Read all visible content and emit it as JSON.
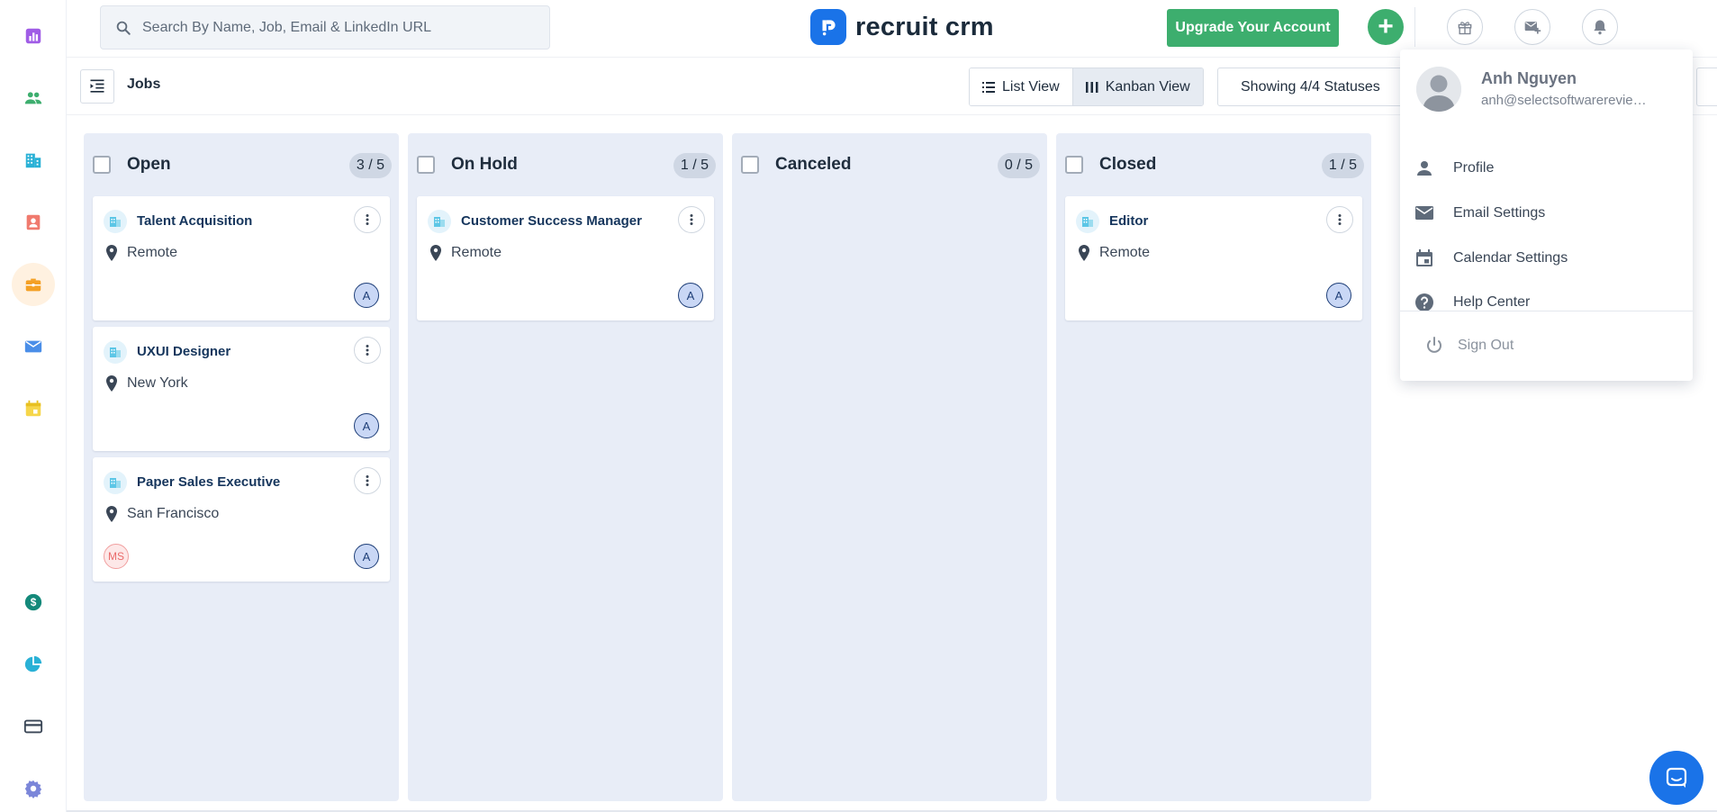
{
  "search": {
    "placeholder": "Search By Name, Job, Email & LinkedIn URL"
  },
  "brand": {
    "name": "recruit crm",
    "accent": "#1a73e8",
    "green": "#3dae6e"
  },
  "header": {
    "upgrade_label": "Upgrade Your Account",
    "add_label": "+"
  },
  "subheader": {
    "title": "Jobs",
    "list_view_label": "List View",
    "kanban_view_label": "Kanban View",
    "status_filter": "Showing 4/4 Statuses"
  },
  "sidebar": {
    "items": [
      {
        "icon": "reports-icon"
      },
      {
        "icon": "candidates-icon"
      },
      {
        "icon": "companies-icon"
      },
      {
        "icon": "contacts-icon"
      },
      {
        "icon": "jobs-icon",
        "active": true
      },
      {
        "icon": "email-icon"
      },
      {
        "icon": "calendar-icon"
      },
      {
        "icon": "billing-icon"
      },
      {
        "icon": "analytics-icon"
      },
      {
        "icon": "card-icon"
      },
      {
        "icon": "settings-icon"
      }
    ]
  },
  "columns": [
    {
      "title": "Open",
      "count": "3 / 5",
      "cards": [
        {
          "title": "Talent Acquisition",
          "location": "Remote",
          "assignee": "A"
        },
        {
          "title": "UXUI Designer",
          "location": "New York",
          "assignee": "A"
        },
        {
          "title": "Paper Sales Executive",
          "location": "San Francisco",
          "assignee": "A",
          "owner": "MS"
        }
      ]
    },
    {
      "title": "On Hold",
      "count": "1 / 5",
      "cards": [
        {
          "title": "Customer Success Manager",
          "location": "Remote",
          "assignee": "A"
        }
      ]
    },
    {
      "title": "Canceled",
      "count": "0 / 5",
      "cards": []
    },
    {
      "title": "Closed",
      "count": "1 / 5",
      "cards": [
        {
          "title": "Editor",
          "location": "Remote",
          "assignee": "A"
        }
      ]
    }
  ],
  "user_menu": {
    "name": "Anh Nguyen",
    "email": "anh@selectsoftwarereviews.com",
    "items": [
      {
        "label": "Profile",
        "icon": "person-icon"
      },
      {
        "label": "Email Settings",
        "icon": "mail-icon"
      },
      {
        "label": "Calendar Settings",
        "icon": "calendar-icon"
      },
      {
        "label": "Help Center",
        "icon": "help-icon"
      }
    ],
    "sign_out": "Sign Out"
  }
}
